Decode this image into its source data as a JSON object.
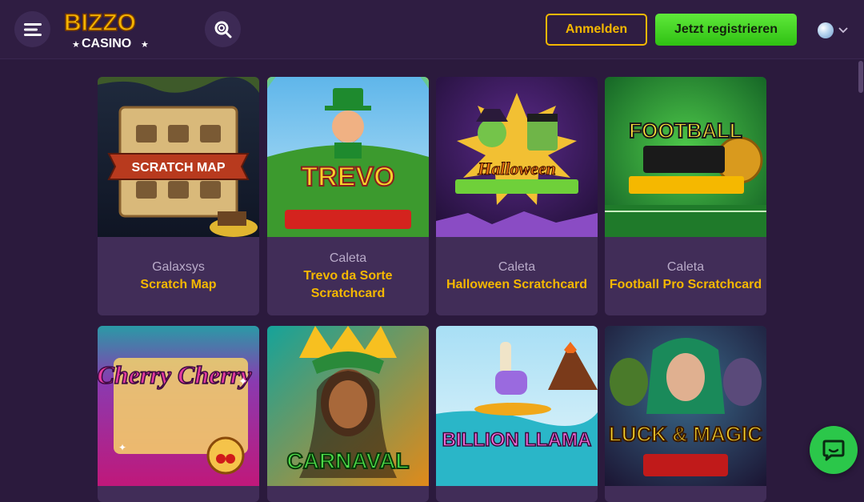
{
  "header": {
    "logo_top": "BIZZO",
    "logo_bottom": "CASINO",
    "login_label": "Anmelden",
    "register_label": "Jetzt registrieren"
  },
  "games": [
    {
      "provider": "Galaxsys",
      "name": "Scratch Map",
      "art": "SCRATCH MAP"
    },
    {
      "provider": "Caleta",
      "name": "Trevo da Sorte Scratchcard",
      "art": "TREVO"
    },
    {
      "provider": "Caleta",
      "name": "Halloween Scratchcard",
      "art": "Halloween"
    },
    {
      "provider": "Caleta",
      "name": "Football Pro Scratchcard",
      "art": "FOOTBALL"
    },
    {
      "art": "Cherry Cherry"
    },
    {
      "art": "CARNAVAL"
    },
    {
      "art": "BILLION LLAMA"
    },
    {
      "art": "LUCK & MAGIC"
    }
  ]
}
